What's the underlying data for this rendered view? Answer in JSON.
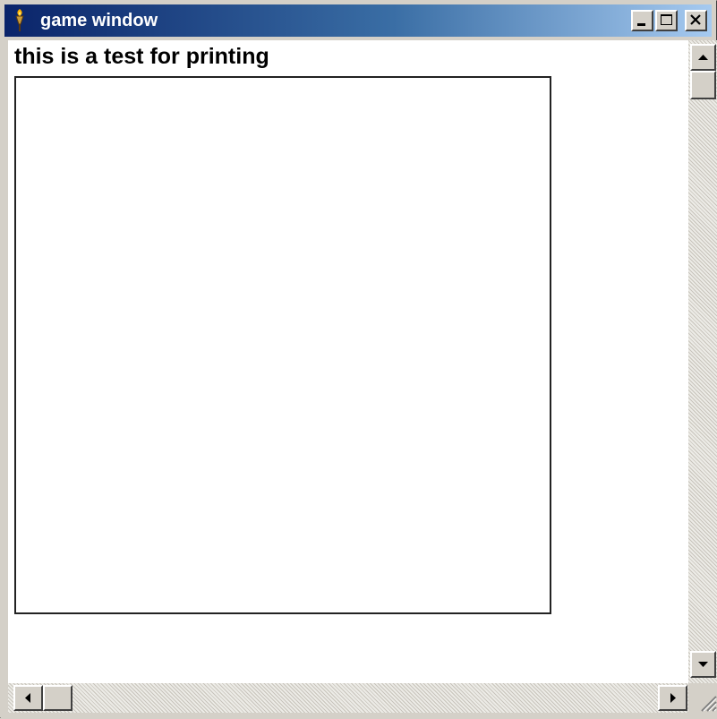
{
  "window": {
    "title": "game window",
    "title_icon": "torch-icon",
    "controls": {
      "minimize_icon": "minimize-icon",
      "maximize_icon": "maximize-icon",
      "close_icon": "close-icon"
    }
  },
  "content": {
    "heading": "this is a test for printing"
  },
  "colors": {
    "titlebar_start": "#0a246a",
    "titlebar_end": "#a6caf0",
    "window_face": "#d4d0c8",
    "client_background": "#ffffff",
    "canvas_border": "#222222"
  }
}
